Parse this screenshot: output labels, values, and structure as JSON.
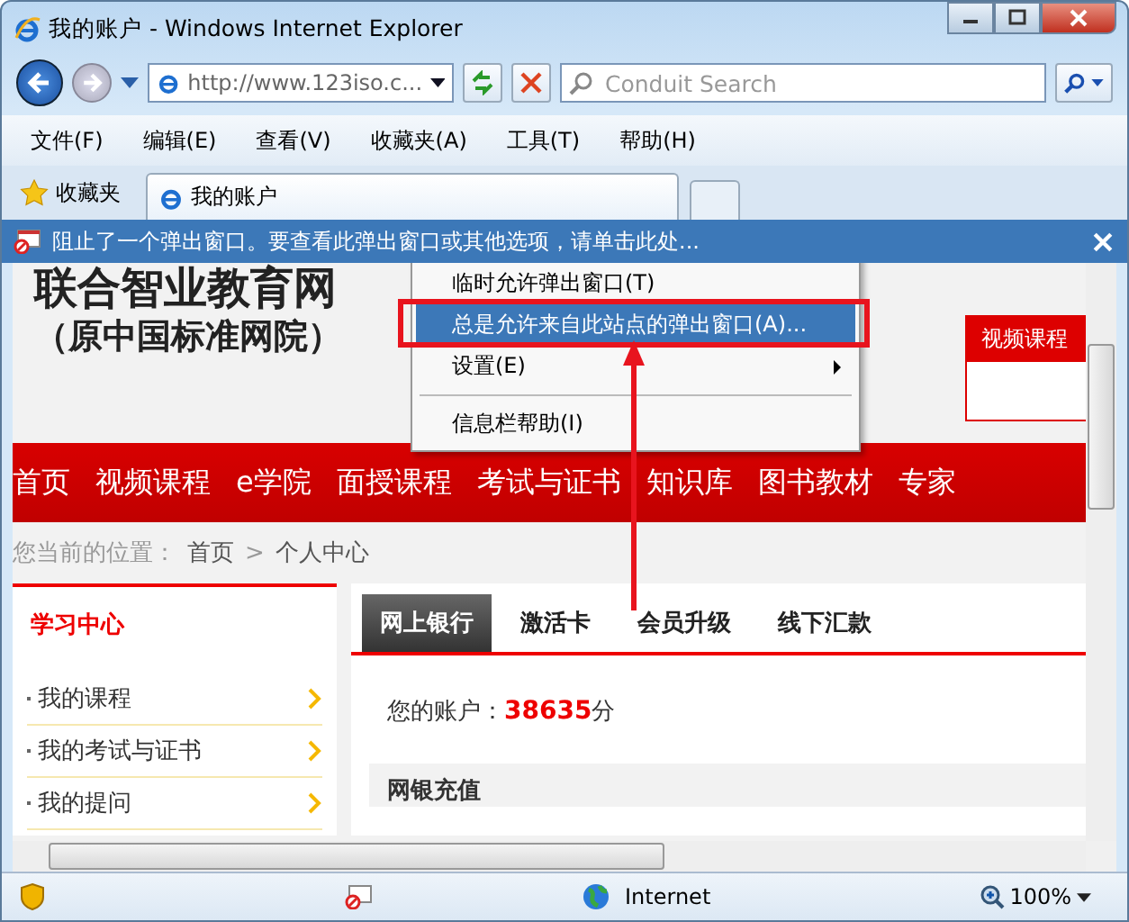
{
  "window": {
    "title": "我的账户 - Windows Internet Explorer"
  },
  "address_bar": {
    "url": "http://www.123iso.c..."
  },
  "search": {
    "placeholder": "Conduit Search"
  },
  "menu_bar": [
    "文件(F)",
    "编辑(E)",
    "查看(V)",
    "收藏夹(A)",
    "工具(T)",
    "帮助(H)"
  ],
  "favorites_button": "收藏夹",
  "tabs": [
    {
      "label": "我的账户",
      "selected": true
    }
  ],
  "info_bar": {
    "message": "阻止了一个弹出窗口。要查看此弹出窗口或其他选项，请单击此处..."
  },
  "popup_menu": [
    {
      "kind": "item",
      "label": "临时允许弹出窗口(T)",
      "selected": false
    },
    {
      "kind": "item",
      "label": "总是允许来自此站点的弹出窗口(A)...",
      "selected": true
    },
    {
      "kind": "submenu",
      "label": "设置(E)",
      "selected": false
    },
    {
      "kind": "separator"
    },
    {
      "kind": "item",
      "label": "信息栏帮助(I)",
      "selected": false
    }
  ],
  "page": {
    "logo_lines": [
      "联合智业教育网",
      "（原中国标准网院）"
    ],
    "side_box": "视频课程",
    "nav": [
      "首页",
      "视频课程",
      "e学院",
      "面授课程",
      "考试与证书",
      "知识库",
      "图书教材",
      "专家"
    ],
    "breadcrumb": {
      "prefix": "您当前的位置：",
      "items": [
        "首页",
        "个人中心"
      ],
      "separator": ">"
    },
    "sidebar": {
      "title": "学习中心",
      "items": [
        "我的课程",
        "我的考试与证书",
        "我的提问"
      ]
    },
    "tabs": [
      {
        "label": "网上银行",
        "selected": true
      },
      {
        "label": "激活卡",
        "selected": false
      },
      {
        "label": "会员升级",
        "selected": false
      },
      {
        "label": "线下汇款",
        "selected": false
      }
    ],
    "account": {
      "label": "您的账户：",
      "points": "38635",
      "unit": "分"
    },
    "section_title": "网银充值"
  },
  "status_bar": {
    "zone": "Internet",
    "zoom": "100%"
  }
}
